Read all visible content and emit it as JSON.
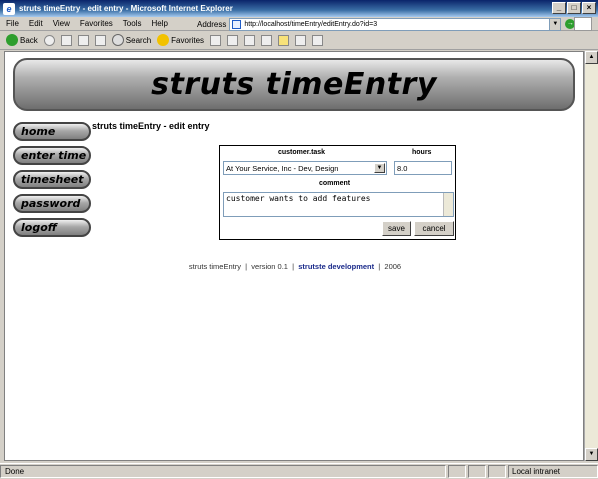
{
  "window": {
    "title": "struts timeEntry - edit entry - Microsoft Internet Explorer"
  },
  "menu": [
    "File",
    "Edit",
    "View",
    "Favorites",
    "Tools",
    "Help"
  ],
  "address": {
    "label": "Address",
    "url": "http://localhost/timeEntry/editEntry.do?id=3",
    "go": "Go"
  },
  "toolbar": {
    "back": "Back",
    "search": "Search",
    "favorites": "Favorites"
  },
  "banner": {
    "title": "struts timeEntry"
  },
  "nav": [
    "home",
    "enter time",
    "timesheet",
    "password",
    "logoff"
  ],
  "page": {
    "title": "struts timeEntry - edit entry"
  },
  "form": {
    "customer_task_label": "customer.task",
    "hours_label": "hours",
    "customer_task_value": "At Your Service, Inc - Dev, Design",
    "hours_value": "8.0",
    "comment_label": "comment",
    "comment_value": "customer wants to add features",
    "save": "save",
    "cancel": "cancel"
  },
  "footer": {
    "app": "struts timeEntry",
    "version": "version 0.1",
    "link": "strutste development",
    "year": "2006",
    "sep": "|"
  },
  "status": {
    "text": "Done",
    "zone": "Local intranet"
  }
}
